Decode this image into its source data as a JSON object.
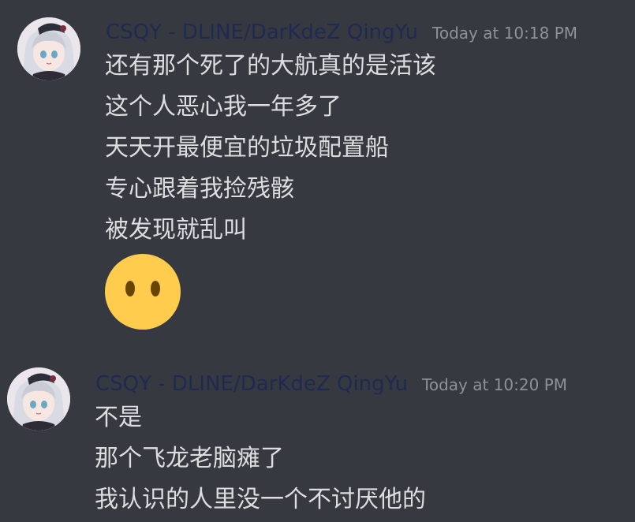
{
  "messages": [
    {
      "username": "CSQY - DLINE/DarKdeZ QingYu",
      "timestamp": "Today at 10:18 PM",
      "lines": [
        "还有那个死了的大航真的是活该",
        "这个人恶心我一年多了",
        "天天开最便宜的垃圾配置船",
        "专心跟着我捡残骸",
        "被发现就乱叫"
      ],
      "emoji": "neutral-face-no-mouth-emoji"
    },
    {
      "username": "CSQY - DLINE/DarKdeZ QingYu",
      "timestamp": "Today at 10:20 PM",
      "lines": [
        "不是",
        "那个飞龙老脑瘫了",
        "我认识的人里没一个不讨厌他的"
      ]
    }
  ],
  "colors": {
    "background": "#36393f",
    "username": "#1f2a52",
    "timestamp": "#8e9297",
    "message_text": "#dcddde",
    "emoji_face": "#ffcc4d"
  }
}
